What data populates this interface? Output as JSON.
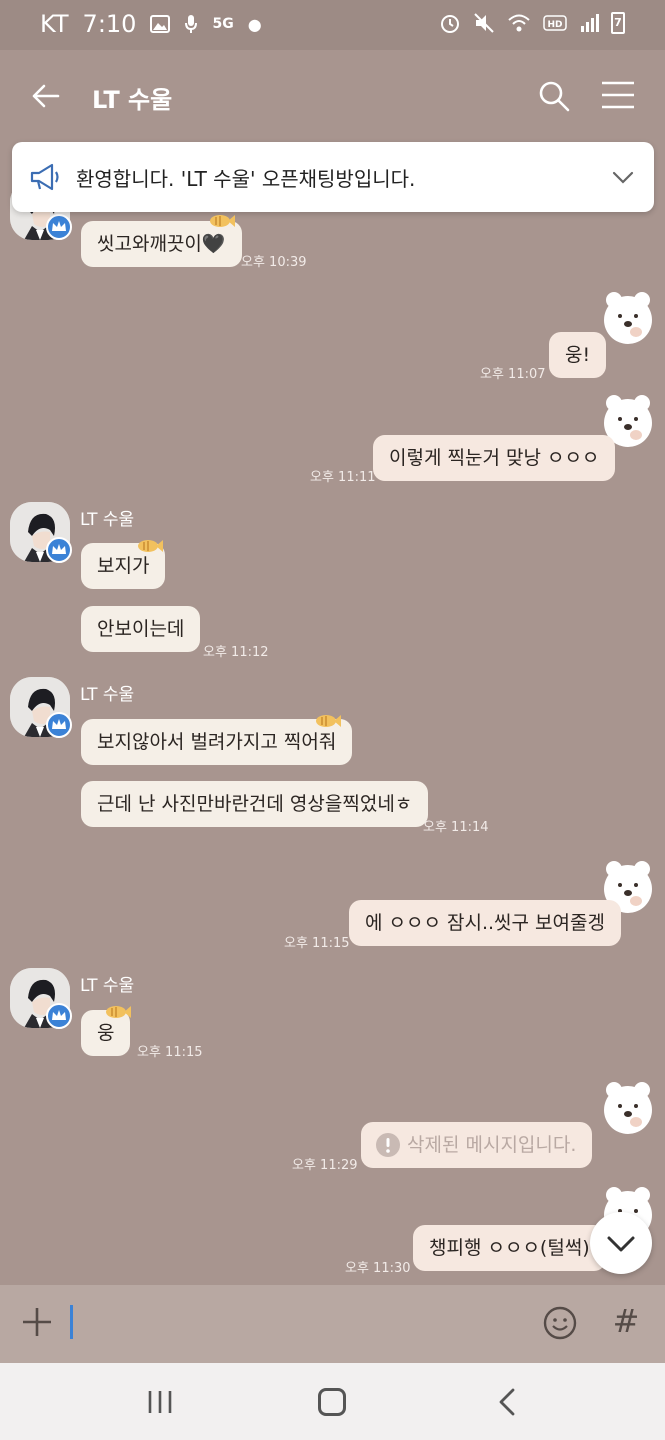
{
  "status_bar": {
    "carrier": "KT",
    "time": "7:10",
    "network": "5G",
    "battery": "7"
  },
  "header": {
    "title": "LT 수울"
  },
  "notice": {
    "text": "환영합니다. 'LT 수울' 오픈채팅방입니다."
  },
  "messages": [
    {
      "sender": "",
      "text": "씻고와깨끗이🖤",
      "time": "오후 10:39"
    },
    {
      "sender": "",
      "text": "웅!",
      "time": "오후 11:07"
    },
    {
      "sender": "",
      "text": "이렇게 찍눈거 맞낭 ㅇㅇㅇ",
      "time": "오후 11:11"
    },
    {
      "sender": "LT 수울",
      "text": "보지가",
      "time": ""
    },
    {
      "sender": "",
      "text": "안보이는데",
      "time": "오후 11:12"
    },
    {
      "sender": "LT 수울",
      "text": "보지않아서 벌려가지고 찍어줘",
      "time": ""
    },
    {
      "sender": "",
      "text": "근데 난 사진만바란건데 영상을찍었네ㅎ",
      "time": "오후 11:14"
    },
    {
      "sender": "",
      "text": "에 ㅇㅇㅇ 잠시..씻구 보여줄겡",
      "time": "오후 11:15"
    },
    {
      "sender": "LT 수울",
      "text": "웅",
      "time": "오후 11:15"
    },
    {
      "sender": "",
      "text": "삭제된 메시지입니다.",
      "time": "오후 11:29"
    },
    {
      "sender": "",
      "text": "챙피행 ㅇㅇㅇ(털썩)",
      "time": "오후 11:30"
    }
  ],
  "colors": {
    "background": "#a8958f",
    "bubble_left": "#f5efe7",
    "bubble_right": "#f6e8e0",
    "badge": "#3b82d6"
  }
}
